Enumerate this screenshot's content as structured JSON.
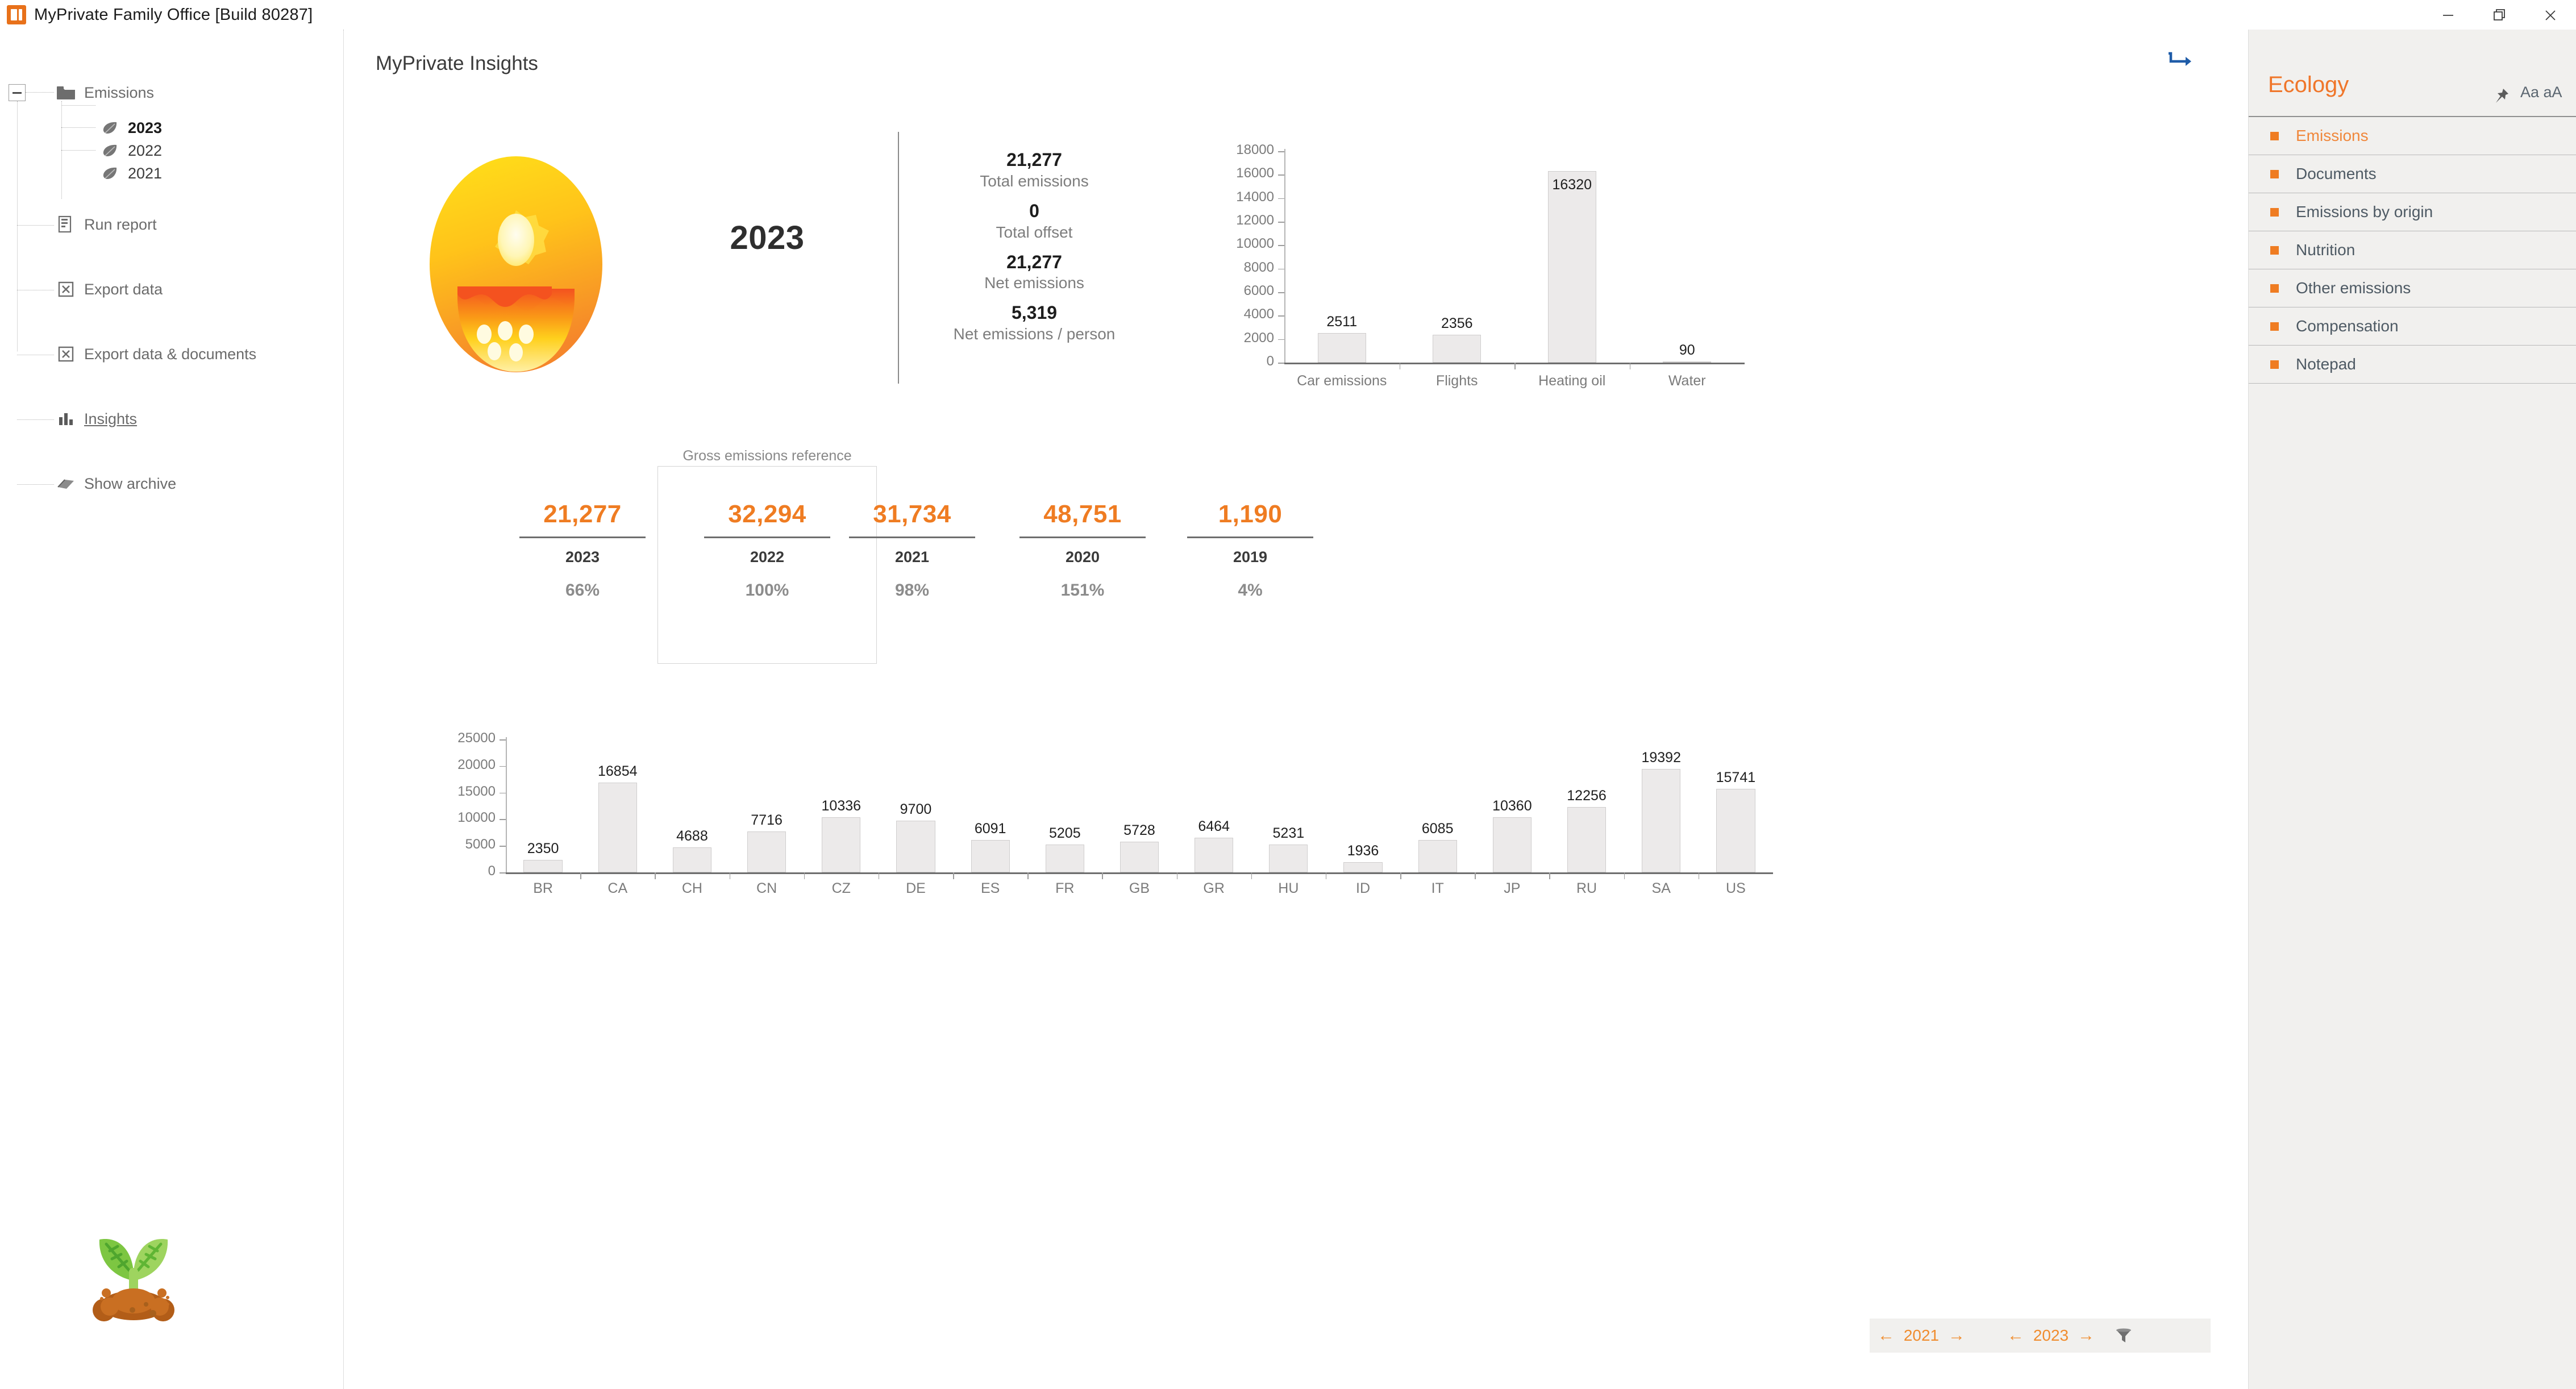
{
  "window": {
    "title": "MyPrivate Family Office [Build 80287]",
    "app_icon": "powerpoint-like-app-icon",
    "minimize": "minimize-icon",
    "restore": "restore-icon",
    "close": "close-icon"
  },
  "tree": {
    "root": {
      "label": "Emissions",
      "icon": "folder-icon"
    },
    "years": [
      {
        "label": "2023",
        "icon": "leaf-icon",
        "selected": true
      },
      {
        "label": "2022",
        "icon": "leaf-icon",
        "selected": false
      },
      {
        "label": "2021",
        "icon": "leaf-icon",
        "selected": false
      }
    ],
    "actions": [
      {
        "label": "Run report",
        "icon": "report-icon"
      },
      {
        "label": "Export data",
        "icon": "export-excel-icon"
      },
      {
        "label": "Export data & documents",
        "icon": "export-excel-icon"
      },
      {
        "label": "Insights",
        "icon": "bar-chart-icon"
      },
      {
        "label": "Show archive",
        "icon": "book-icon"
      }
    ],
    "decoration_icon": "seedling-emoji"
  },
  "main": {
    "page_title": "MyPrivate Insights",
    "forward_icon": "forward-arrow-icon",
    "hero": {
      "face_icon": "smiling-sun-face-emoji",
      "year": "2023",
      "kpis": [
        {
          "value": "21,277",
          "label": "Total emissions"
        },
        {
          "value": "0",
          "label": "Total offset"
        },
        {
          "value": "21,277",
          "label": "Net emissions"
        },
        {
          "value": "5,319",
          "label": "Net emissions / person"
        }
      ]
    },
    "comparison": {
      "reference_note": "Gross emissions reference",
      "cards": [
        {
          "value": "21,277",
          "year": "2023",
          "percent": "66%",
          "reference": false
        },
        {
          "value": "32,294",
          "year": "2022",
          "percent": "100%",
          "reference": true
        },
        {
          "value": "31,734",
          "year": "2021",
          "percent": "98%",
          "reference": false
        },
        {
          "value": "48,751",
          "year": "2020",
          "percent": "151%",
          "reference": false
        },
        {
          "value": "1,190",
          "year": "2019",
          "percent": "4%",
          "reference": false
        }
      ]
    },
    "footer": {
      "nav_left": {
        "prev": "←",
        "value": "2021",
        "next": "→"
      },
      "nav_right": {
        "prev": "←",
        "value": "2023",
        "next": "→"
      },
      "filter_icon": "funnel-filter-icon",
      "back_button_icon": "circle-back-arrow-icon"
    }
  },
  "right_panel": {
    "title": "Ecology",
    "pin_icon": "pin-icon",
    "font_size_label": "Aa aA",
    "items": [
      {
        "label": "Emissions",
        "active": true
      },
      {
        "label": "Documents",
        "active": false
      },
      {
        "label": "Emissions by origin",
        "active": false
      },
      {
        "label": "Nutrition",
        "active": false
      },
      {
        "label": "Other emissions",
        "active": false
      },
      {
        "label": "Compensation",
        "active": false
      },
      {
        "label": "Notepad",
        "active": false
      }
    ]
  },
  "colors": {
    "accent_orange": "#ef7c22",
    "panel_bg": "#f1f0ee",
    "bar_fill": "#eceaea",
    "bar_stroke": "#cfcdcd",
    "muted_text": "#7b7b7b"
  },
  "chart_data": [
    {
      "type": "bar",
      "id": "emissions-by-category",
      "title": "",
      "categories": [
        "Car emissions",
        "Flights",
        "Heating oil",
        "Water"
      ],
      "values": [
        2511,
        2356,
        16320,
        90
      ],
      "xlabel": "",
      "ylabel": "",
      "ylim": [
        0,
        18000
      ],
      "yticks": [
        0,
        2000,
        4000,
        6000,
        8000,
        10000,
        12000,
        14000,
        16000,
        18000
      ],
      "grid": false,
      "data_labels": true,
      "legend": "none"
    },
    {
      "type": "bar",
      "id": "emissions-by-country",
      "title": "",
      "categories": [
        "BR",
        "CA",
        "CH",
        "CN",
        "CZ",
        "DE",
        "ES",
        "FR",
        "GB",
        "GR",
        "HU",
        "ID",
        "IT",
        "JP",
        "RU",
        "SA",
        "US"
      ],
      "values": [
        2350,
        16854,
        4688,
        7716,
        10336,
        9700,
        6091,
        5205,
        5728,
        6464,
        5231,
        1936,
        6085,
        10360,
        12256,
        19392,
        15741
      ],
      "xlabel": "",
      "ylabel": "",
      "ylim": [
        0,
        25000
      ],
      "yticks": [
        0,
        5000,
        10000,
        15000,
        20000,
        25000
      ],
      "grid": false,
      "data_labels": true,
      "legend": "none"
    }
  ]
}
